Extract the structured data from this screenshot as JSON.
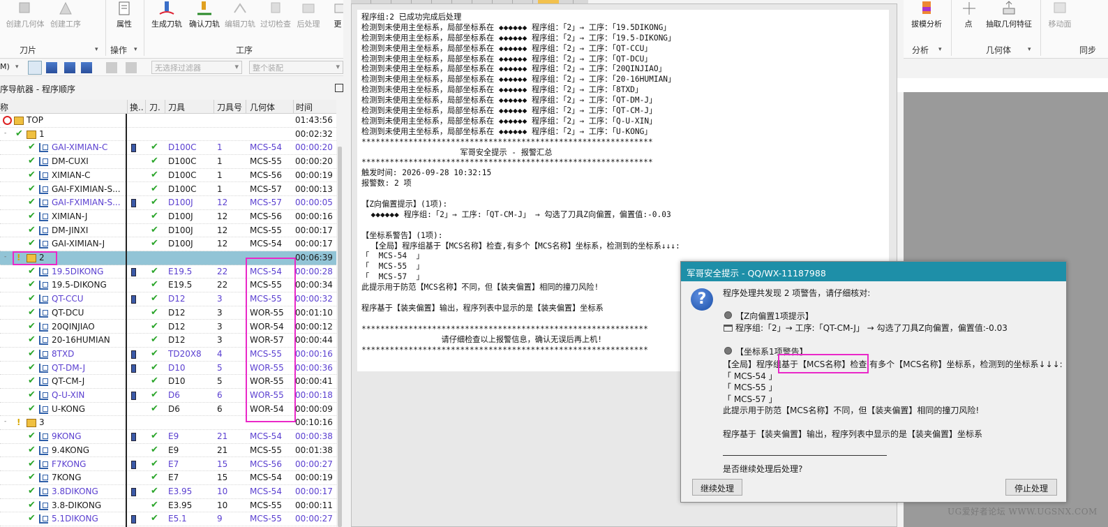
{
  "ribbon": {
    "tools_left": [
      "创建几何体",
      "创建工序",
      "属性",
      "生成刀轨",
      "确认刀轨",
      "编辑刀轨",
      "过切检查",
      "后处理",
      "更"
    ],
    "groups_left": [
      "刀片",
      "操作",
      "工序"
    ],
    "tools_right": [
      "拔模分析",
      "点",
      "抽取几何特征",
      "移动面"
    ],
    "groups_right": [
      "分析",
      "几何体",
      "同步"
    ]
  },
  "toolbar": {
    "left_label": "M)",
    "filter_placeholder": "无选择过滤器",
    "assembly_placeholder": "整个装配"
  },
  "navigator": {
    "title": "序导航器 - 程序顺序",
    "columns": [
      "称",
      "换..",
      "刀.",
      "刀具",
      "刀具号",
      "几何体",
      "时间"
    ],
    "rows": [
      {
        "name": "TOP",
        "tool": "",
        "num": "",
        "geo": "",
        "time": "01:43:56",
        "blue": false,
        "level": 0,
        "chk": false,
        "chg": false
      },
      {
        "name": "1",
        "tool": "",
        "num": "",
        "geo": "",
        "time": "00:02:32",
        "blue": false,
        "level": 1,
        "chk": true,
        "chg": false
      },
      {
        "name": "GAI-XIMIAN-C",
        "tool": "D100C",
        "num": "1",
        "geo": "MCS-54",
        "time": "00:00:20",
        "blue": true,
        "level": 2,
        "chk": true,
        "chg": true
      },
      {
        "name": "DM-CUXI",
        "tool": "D100C",
        "num": "1",
        "geo": "MCS-55",
        "time": "00:00:20",
        "blue": false,
        "level": 2,
        "chk": true,
        "chg": false
      },
      {
        "name": "XIMIAN-C",
        "tool": "D100C",
        "num": "1",
        "geo": "MCS-56",
        "time": "00:00:19",
        "blue": false,
        "level": 2,
        "chk": true,
        "chg": false
      },
      {
        "name": "GAI-FXIMIAN-S...",
        "tool": "D100C",
        "num": "1",
        "geo": "MCS-57",
        "time": "00:00:13",
        "blue": false,
        "level": 2,
        "chk": true,
        "chg": false
      },
      {
        "name": "GAI-FXIMIAN-S...",
        "tool": "D100J",
        "num": "12",
        "geo": "MCS-57",
        "time": "00:00:05",
        "blue": true,
        "level": 2,
        "chk": true,
        "chg": true
      },
      {
        "name": "XIMIAN-J",
        "tool": "D100J",
        "num": "12",
        "geo": "MCS-56",
        "time": "00:00:16",
        "blue": false,
        "level": 2,
        "chk": true,
        "chg": false
      },
      {
        "name": "DM-JINXI",
        "tool": "D100J",
        "num": "12",
        "geo": "MCS-55",
        "time": "00:00:17",
        "blue": false,
        "level": 2,
        "chk": true,
        "chg": false
      },
      {
        "name": "GAI-XIMIAN-J",
        "tool": "D100J",
        "num": "12",
        "geo": "MCS-54",
        "time": "00:00:17",
        "blue": false,
        "level": 2,
        "chk": true,
        "chg": false
      },
      {
        "name": "2",
        "tool": "",
        "num": "",
        "geo": "",
        "time": "00:06:39",
        "blue": false,
        "level": 1,
        "chk": false,
        "chg": false,
        "sel": true
      },
      {
        "name": "19.5DIKONG",
        "tool": "E19.5",
        "num": "22",
        "geo": "MCS-54",
        "time": "00:00:28",
        "blue": true,
        "level": 2,
        "chk": true,
        "chg": true
      },
      {
        "name": "19.5-DIKONG",
        "tool": "E19.5",
        "num": "22",
        "geo": "MCS-55",
        "time": "00:00:34",
        "blue": false,
        "level": 2,
        "chk": true,
        "chg": false
      },
      {
        "name": "QT-CCU",
        "tool": "D12",
        "num": "3",
        "geo": "MCS-55",
        "time": "00:00:32",
        "blue": true,
        "level": 2,
        "chk": true,
        "chg": true
      },
      {
        "name": "QT-DCU",
        "tool": "D12",
        "num": "3",
        "geo": "WOR-55",
        "time": "00:01:10",
        "blue": false,
        "level": 2,
        "chk": true,
        "chg": false
      },
      {
        "name": "20QINJIAO",
        "tool": "D12",
        "num": "3",
        "geo": "WOR-54",
        "time": "00:00:12",
        "blue": false,
        "level": 2,
        "chk": true,
        "chg": false
      },
      {
        "name": "20-16HUMIAN",
        "tool": "D12",
        "num": "3",
        "geo": "WOR-57",
        "time": "00:00:44",
        "blue": false,
        "level": 2,
        "chk": true,
        "chg": false
      },
      {
        "name": "8TXD",
        "tool": "TD20X8",
        "num": "4",
        "geo": "MCS-55",
        "time": "00:00:16",
        "blue": true,
        "level": 2,
        "chk": true,
        "chg": true
      },
      {
        "name": "QT-DM-J",
        "tool": "D10",
        "num": "5",
        "geo": "WOR-55",
        "time": "00:00:36",
        "blue": true,
        "level": 2,
        "chk": true,
        "chg": true
      },
      {
        "name": "QT-CM-J",
        "tool": "D10",
        "num": "5",
        "geo": "WOR-55",
        "time": "00:00:41",
        "blue": false,
        "level": 2,
        "chk": true,
        "chg": false
      },
      {
        "name": "Q-U-XIN",
        "tool": "D6",
        "num": "6",
        "geo": "WOR-55",
        "time": "00:00:18",
        "blue": true,
        "level": 2,
        "chk": true,
        "chg": true
      },
      {
        "name": "U-KONG",
        "tool": "D6",
        "num": "6",
        "geo": "WOR-54",
        "time": "00:00:09",
        "blue": false,
        "level": 2,
        "chk": true,
        "chg": false
      },
      {
        "name": "3",
        "tool": "",
        "num": "",
        "geo": "",
        "time": "00:10:16",
        "blue": false,
        "level": 1,
        "chk": false,
        "chg": false
      },
      {
        "name": "9KONG",
        "tool": "E9",
        "num": "21",
        "geo": "MCS-54",
        "time": "00:00:38",
        "blue": true,
        "level": 2,
        "chk": true,
        "chg": true
      },
      {
        "name": "9.4KONG",
        "tool": "E9",
        "num": "21",
        "geo": "MCS-55",
        "time": "00:01:38",
        "blue": false,
        "level": 2,
        "chk": true,
        "chg": false
      },
      {
        "name": "F7KONG",
        "tool": "E7",
        "num": "15",
        "geo": "MCS-56",
        "time": "00:00:27",
        "blue": true,
        "level": 2,
        "chk": true,
        "chg": true
      },
      {
        "name": "7KONG",
        "tool": "E7",
        "num": "15",
        "geo": "MCS-54",
        "time": "00:00:19",
        "blue": false,
        "level": 2,
        "chk": true,
        "chg": false
      },
      {
        "name": "3.8DIKONG",
        "tool": "E3.95",
        "num": "10",
        "geo": "MCS-54",
        "time": "00:00:17",
        "blue": true,
        "level": 2,
        "chk": true,
        "chg": true
      },
      {
        "name": "3.8-DIKONG",
        "tool": "E3.95",
        "num": "10",
        "geo": "MCS-55",
        "time": "00:00:11",
        "blue": false,
        "level": 2,
        "chk": true,
        "chg": false
      },
      {
        "name": "5.1DIKONG",
        "tool": "E5.1",
        "num": "9",
        "geo": "MCS-55",
        "time": "00:00:27",
        "blue": true,
        "level": 2,
        "chk": true,
        "chg": true
      }
    ]
  },
  "log": {
    "lines": [
      "程序组:2 已成功完成后处理",
      "检测到未使用主坐标系，局部坐标系在 ◆◆◆◆◆◆ 程序组：「2」→ 工序：「19.5DIKONG」",
      "检测到未使用主坐标系，局部坐标系在 ◆◆◆◆◆◆ 程序组：「2」→ 工序：「19.5-DIKONG」",
      "检测到未使用主坐标系，局部坐标系在 ◆◆◆◆◆◆ 程序组：「2」→ 工序：「QT-CCU」",
      "检测到未使用主坐标系，局部坐标系在 ◆◆◆◆◆◆ 程序组：「2」→ 工序：「QT-DCU」",
      "检测到未使用主坐标系，局部坐标系在 ◆◆◆◆◆◆ 程序组：「2」→ 工序：「20QINJIAO」",
      "检测到未使用主坐标系，局部坐标系在 ◆◆◆◆◆◆ 程序组：「2」→ 工序：「20-16HUMIAN」",
      "检测到未使用主坐标系，局部坐标系在 ◆◆◆◆◆◆ 程序组：「2」→ 工序：「8TXD」",
      "检测到未使用主坐标系，局部坐标系在 ◆◆◆◆◆◆ 程序组：「2」→ 工序：「QT-DM-J」",
      "检测到未使用主坐标系，局部坐标系在 ◆◆◆◆◆◆ 程序组：「2」→ 工序：「QT-CM-J」",
      "检测到未使用主坐标系，局部坐标系在 ◆◆◆◆◆◆ 程序组：「2」→ 工序：「Q-U-XIN」",
      "检测到未使用主坐标系，局部坐标系在 ◆◆◆◆◆◆ 程序组：「2」→ 工序：「U-KONG」",
      "**************************************************************",
      "                     军哥安全提示 - 报警汇总",
      "**************************************************************",
      "触发时间: 2026-09-28 10:32:15",
      "报警数: 2 项",
      "",
      "【Z向偏置提示】(1项):",
      "  ◆◆◆◆◆◆ 程序组:「2」→ 工序:「QT-CM-J」 → 勾选了刀具Z向偏置，偏置值:-0.03",
      "",
      "【坐标系警告】(1项):",
      "  【全局】程序组基于【MCS名称】检查,有多个【MCS名称】坐标系，检测到的坐标系↓↓↓:",
      "「  MCS-54  」",
      "「  MCS-55  」",
      "「  MCS-57  」",
      "此提示用于防范【MCS名称】不同，但【装夹偏置】相同的撞刀风险!",
      "",
      "程序基于【装夹偏置】输出，程序列表中显示的是【装夹偏置】坐标系",
      "",
      "*************************************************************",
      "                 请仔细检查以上报警信息，确认无误后再上机!",
      "*************************************************************"
    ]
  },
  "dialog": {
    "title": "军哥安全提示 - QQ/WX-11187988",
    "intro": "程序处理共发现 2 项警告，请仔细核对:",
    "sec1_title": "【Z向偏置1项提示】",
    "sec1_line": "程序组:「2」→ 工序:「QT-CM-J」 → 勾选了刀具Z向偏置，偏置值:-0.03",
    "sec2_title": "【坐标系1项警告】",
    "sec2_line": "【全局】程序组基于【MCS名称】检查,有多个【MCS名称】坐标系，检测到的坐标系↓↓↓:",
    "mcs": [
      "「  MCS-54  」",
      "「  MCS-55  」",
      "「  MCS-57  」"
    ],
    "warn": "此提示用于防范【MCS名称】不同，但【装夹偏置】相同的撞刀风险!",
    "note": "程序基于【装夹偏置】输出，程序列表中显示的是【装夹偏置】坐标系",
    "question": "是否继续处理后处理?",
    "continue_btn": "继续处理",
    "stop_btn": "停止处理"
  },
  "watermark": "UG爱好者论坛 WWW.UGSNX.COM",
  "colors": {
    "accent": "#1e8fa8",
    "highlight": "#ea28c8",
    "selected_row": "#92c4d6",
    "op_blue": "#5a3fd0"
  }
}
